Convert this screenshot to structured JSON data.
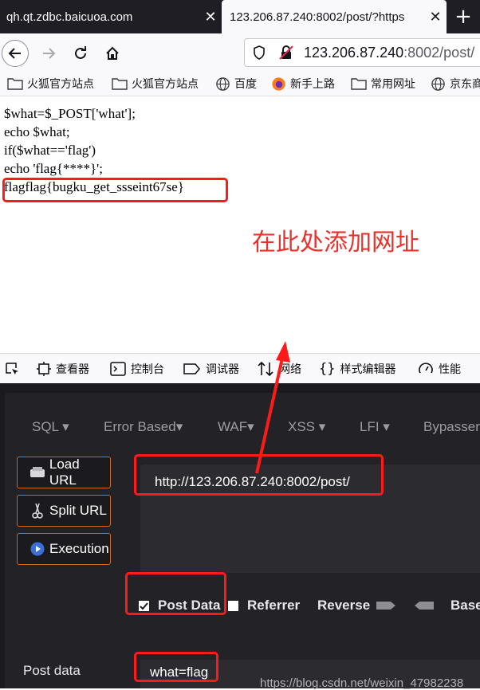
{
  "tabs": [
    {
      "title": "qh.qt.zdbc.baicuoa.com",
      "close": "✕"
    },
    {
      "title": "123.206.87.240:8002/post/?https",
      "close": "✕"
    }
  ],
  "new_tab": "+",
  "address": {
    "host": "123.206.87.240",
    "rest": ":8002/post/"
  },
  "bookmarks": [
    "火狐官方站点",
    "火狐官方站点",
    "百度",
    "新手上路",
    "常用网址",
    "京东商"
  ],
  "page": {
    "code_lines": [
      "$what=$_POST['what'];",
      "echo $what;",
      "if($what=='flag')",
      "echo 'flag{****}';",
      "flagflag{bugku_get_ssseint67se}"
    ],
    "annotation": "在此处添加网址"
  },
  "devtools": [
    "查看器",
    "控制台",
    "调试器",
    "网络",
    "样式编辑器",
    "性能"
  ],
  "hackbar": {
    "menu": [
      "SQL ▾",
      "Error Based▾",
      "WAF▾",
      "XSS ▾",
      "LFI ▾",
      "Bypasser"
    ],
    "load_url": "Load URL",
    "split_url": "Split URL",
    "execution": "Execution",
    "url_value": "http://123.206.87.240:8002/post/",
    "options": {
      "post_data": "Post Data",
      "referrer": "Referrer",
      "reverse": "Reverse",
      "base": "Base"
    },
    "post_data_label": "Post data",
    "post_data_value": "what=flag"
  },
  "watermark": "https://blog.csdn.net/weixin_47982238",
  "colors": {
    "accent": "#ff1a1a",
    "annotation": "#e8322c",
    "button_border": "#c96a1a"
  }
}
